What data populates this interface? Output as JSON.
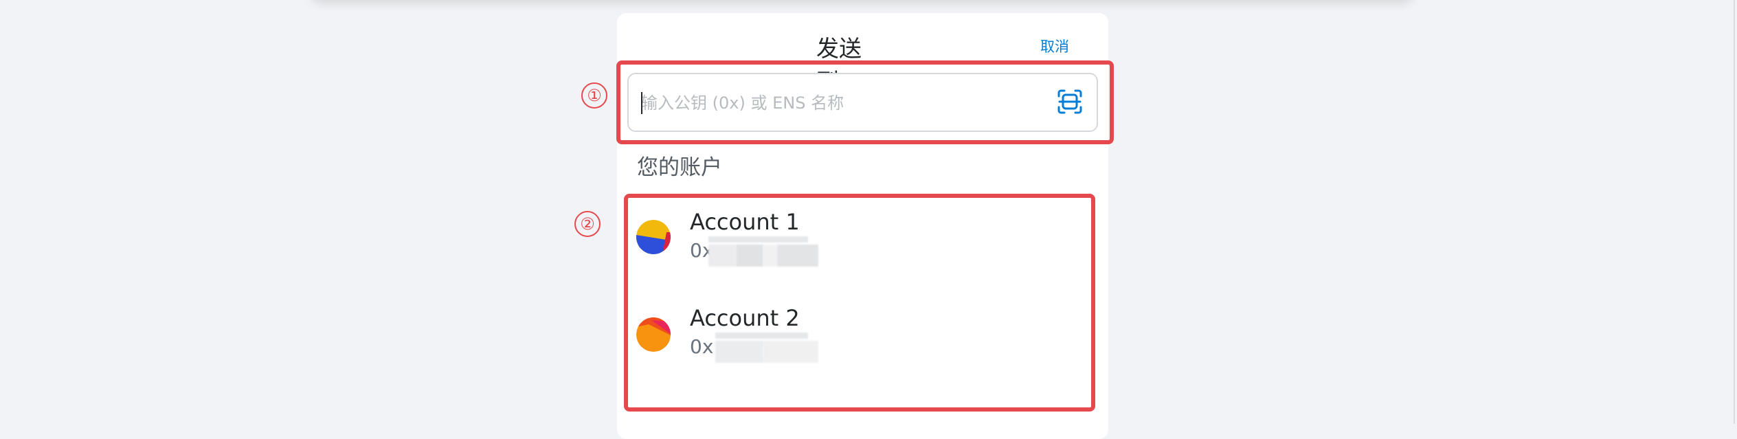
{
  "header": {
    "title": "发送到",
    "cancel_label": "取消"
  },
  "search": {
    "placeholder": "输入公钥 (0x) 或 ENS 名称",
    "value": "",
    "scan_icon": "qr-scan-icon"
  },
  "accounts_section": {
    "title": "您的账户",
    "accounts": [
      {
        "name": "Account 1",
        "address_prefix": "0x",
        "avatar_colors": [
          "#f0b90b",
          "#2d4fd9",
          "#d9233f"
        ]
      },
      {
        "name": "Account 2",
        "address_prefix": "0x",
        "avatar_colors": [
          "#f7930e",
          "#e8265a",
          "#f04d1e"
        ]
      }
    ]
  },
  "annotations": {
    "marker_1": "①",
    "marker_2": "②",
    "color": "#e5484d"
  },
  "colors": {
    "accent": "#037dd6",
    "background": "#f2f3f6"
  }
}
